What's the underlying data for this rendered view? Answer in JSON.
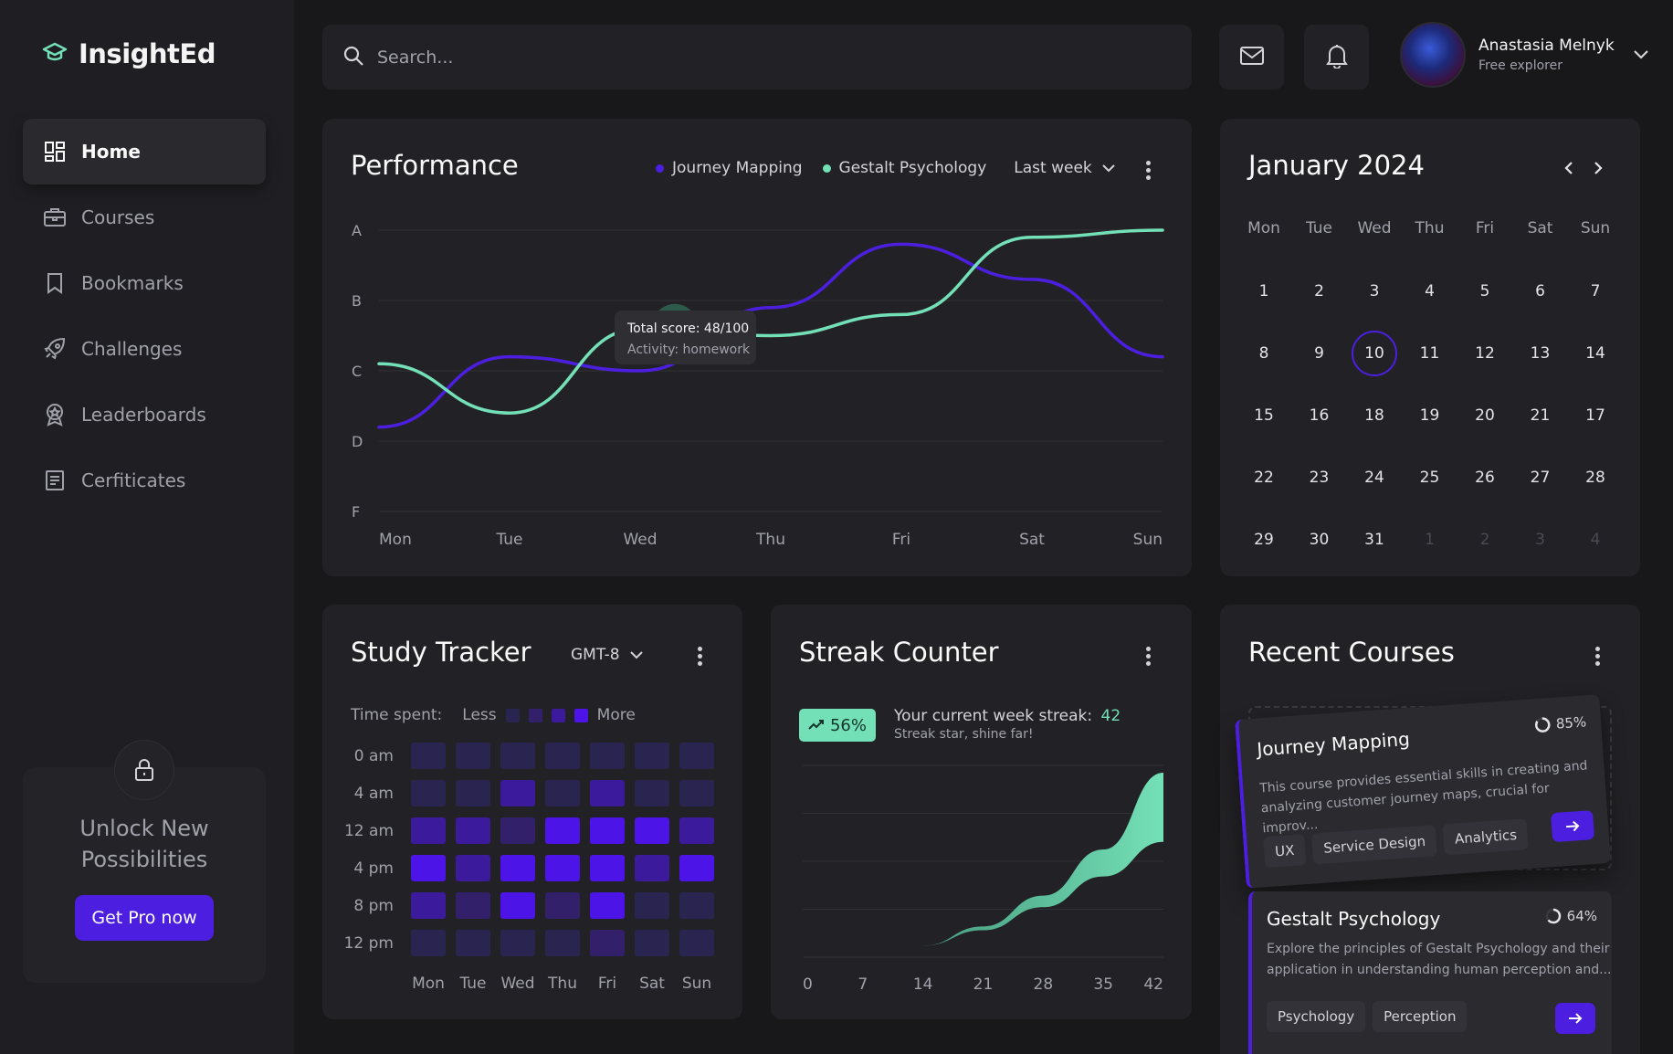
{
  "app": {
    "name": "InsightEd"
  },
  "colors": {
    "accent": "#4c1fe0",
    "mint": "#74e0b7",
    "bg": "#18181b",
    "card": "#222226"
  },
  "nav": {
    "items": [
      {
        "label": "Home",
        "icon": "dashboard-icon",
        "active": true
      },
      {
        "label": "Courses",
        "icon": "briefcase-icon"
      },
      {
        "label": "Bookmarks",
        "icon": "bookmark-icon"
      },
      {
        "label": "Challenges",
        "icon": "rocket-icon"
      },
      {
        "label": "Leaderboards",
        "icon": "award-icon"
      },
      {
        "label": "Cerfiticates",
        "icon": "certificate-icon"
      }
    ]
  },
  "promo": {
    "line1": "Unlock New",
    "line2": "Possibilities",
    "button": "Get Pro now"
  },
  "search": {
    "placeholder": "Search..."
  },
  "user": {
    "name": "Anastasia Melnyk",
    "role": "Free explorer"
  },
  "performance": {
    "title": "Performance",
    "legend": [
      "Journey Mapping",
      "Gestalt Psychology"
    ],
    "range": "Last week",
    "tooltip": {
      "score": "Total score: 48/100",
      "activity": "Activity: homework"
    }
  },
  "chart_data": [
    {
      "type": "line",
      "title": "Performance",
      "categories": [
        "Mon",
        "Tue",
        "Wed",
        "Thu",
        "Fri",
        "Sat",
        "Sun"
      ],
      "y_ticks": [
        "A",
        "B",
        "C",
        "D",
        "F"
      ],
      "grid": true,
      "legend_position": "top",
      "series": [
        {
          "name": "Journey Mapping",
          "color": "#4c1fe0",
          "values": [
            1.2,
            2.2,
            2.0,
            2.9,
            3.8,
            3.3,
            2.2
          ]
        },
        {
          "name": "Gestalt Psychology",
          "color": "#74e0b7",
          "values": [
            2.1,
            1.4,
            2.6,
            2.5,
            2.8,
            3.9,
            4.0
          ]
        }
      ]
    },
    {
      "type": "heatmap",
      "title": "Study Tracker",
      "x": [
        "Mon",
        "Tue",
        "Wed",
        "Thu",
        "Fri",
        "Sat",
        "Sun"
      ],
      "y": [
        "0 am",
        "4 am",
        "12 am",
        "4 pm",
        "8 pm",
        "12 pm"
      ],
      "values": [
        [
          1,
          1,
          1,
          1,
          1,
          1,
          1
        ],
        [
          1,
          1,
          3,
          1,
          3,
          1,
          1
        ],
        [
          3,
          3,
          2,
          4,
          4,
          4,
          3
        ],
        [
          4,
          3,
          4,
          4,
          4,
          3,
          4
        ],
        [
          3,
          2,
          4,
          2,
          4,
          1,
          1
        ],
        [
          1,
          1,
          1,
          1,
          2,
          1,
          1
        ]
      ]
    },
    {
      "type": "area",
      "title": "Streak Counter",
      "x": [
        0,
        7,
        14,
        21,
        28,
        35,
        42
      ],
      "series": [
        {
          "name": "upper",
          "values": [
            0,
            1,
            3,
            8,
            16,
            28,
            48
          ]
        },
        {
          "name": "lower",
          "values": [
            0,
            1,
            3,
            7,
            13,
            21,
            30
          ]
        }
      ]
    }
  ],
  "calendar": {
    "title": "January 2024",
    "weekdays": [
      "Mon",
      "Tue",
      "Wed",
      "Thu",
      "Fri",
      "Sat",
      "Sun"
    ],
    "days": [
      "1",
      "2",
      "3",
      "4",
      "5",
      "6",
      "7",
      "8",
      "9",
      "10",
      "11",
      "12",
      "13",
      "14",
      "15",
      "16",
      "18",
      "19",
      "20",
      "21",
      "17",
      "22",
      "23",
      "24",
      "25",
      "26",
      "27",
      "28",
      "29",
      "30",
      "31",
      "1",
      "2",
      "3",
      "4"
    ],
    "today": "10"
  },
  "study": {
    "title": "Study Tracker",
    "timezone": "GMT-8",
    "time_spent": "Time spent:",
    "less": "Less",
    "more": "More"
  },
  "streak": {
    "title": "Streak Counter",
    "badge": "56%",
    "text": "Your current week streak:",
    "count": "42",
    "sub": "Streak star, shine far!"
  },
  "recent": {
    "title": "Recent Courses",
    "courses": [
      {
        "name": "Journey Mapping",
        "progress": "85%",
        "desc1": "This course provides essential skills in creating and",
        "desc2": "analyzing customer journey maps, crucial for improv...",
        "tags": [
          "UX",
          "Service Design",
          "Analytics"
        ]
      },
      {
        "name": "Gestalt Psychology",
        "progress": "64%",
        "desc1": "Explore the principles of Gestalt Psychology and their",
        "desc2": "application in understanding human perception and...",
        "tags": [
          "Psychology",
          "Perception"
        ]
      }
    ]
  }
}
